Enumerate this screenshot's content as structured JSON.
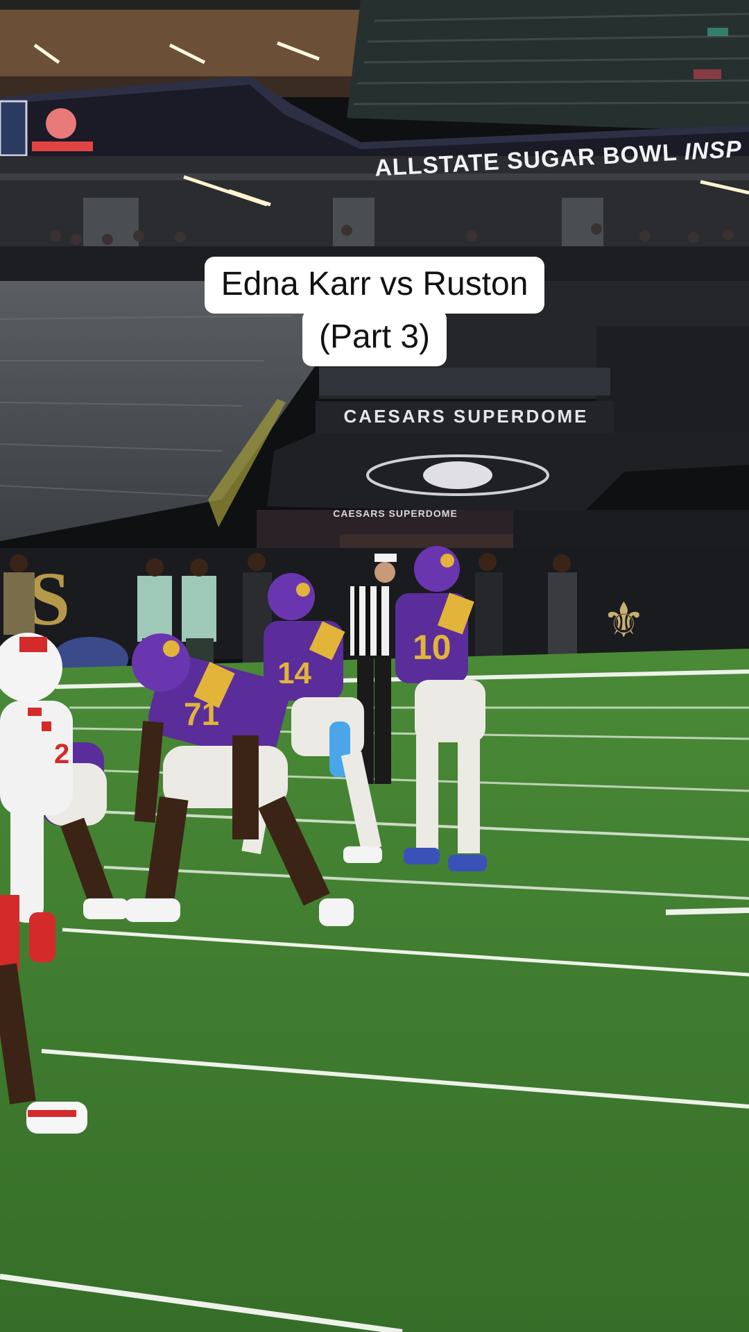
{
  "caption": {
    "line1": "Edna Karr vs Ruston",
    "line2": "(Part 3)"
  },
  "scene": {
    "ribbon_text": "ALLSTATE SUGAR BOWL",
    "ribbon_text_cut": "INSP",
    "dome_sign": "CAESARS SUPERDOME",
    "dome_sign_small": "CAESARS SUPERDOME",
    "endzone_text": "S",
    "jerseys": {
      "lineman": "71",
      "receiver": "14",
      "quarterback": "10",
      "defender": "2"
    }
  },
  "colors": {
    "turf": "#3d7a2f",
    "team_purple": "#5b2d9a",
    "team_gold": "#e2b43a",
    "opponent_red": "#d42a2a",
    "dome_dark": "#17191c"
  }
}
